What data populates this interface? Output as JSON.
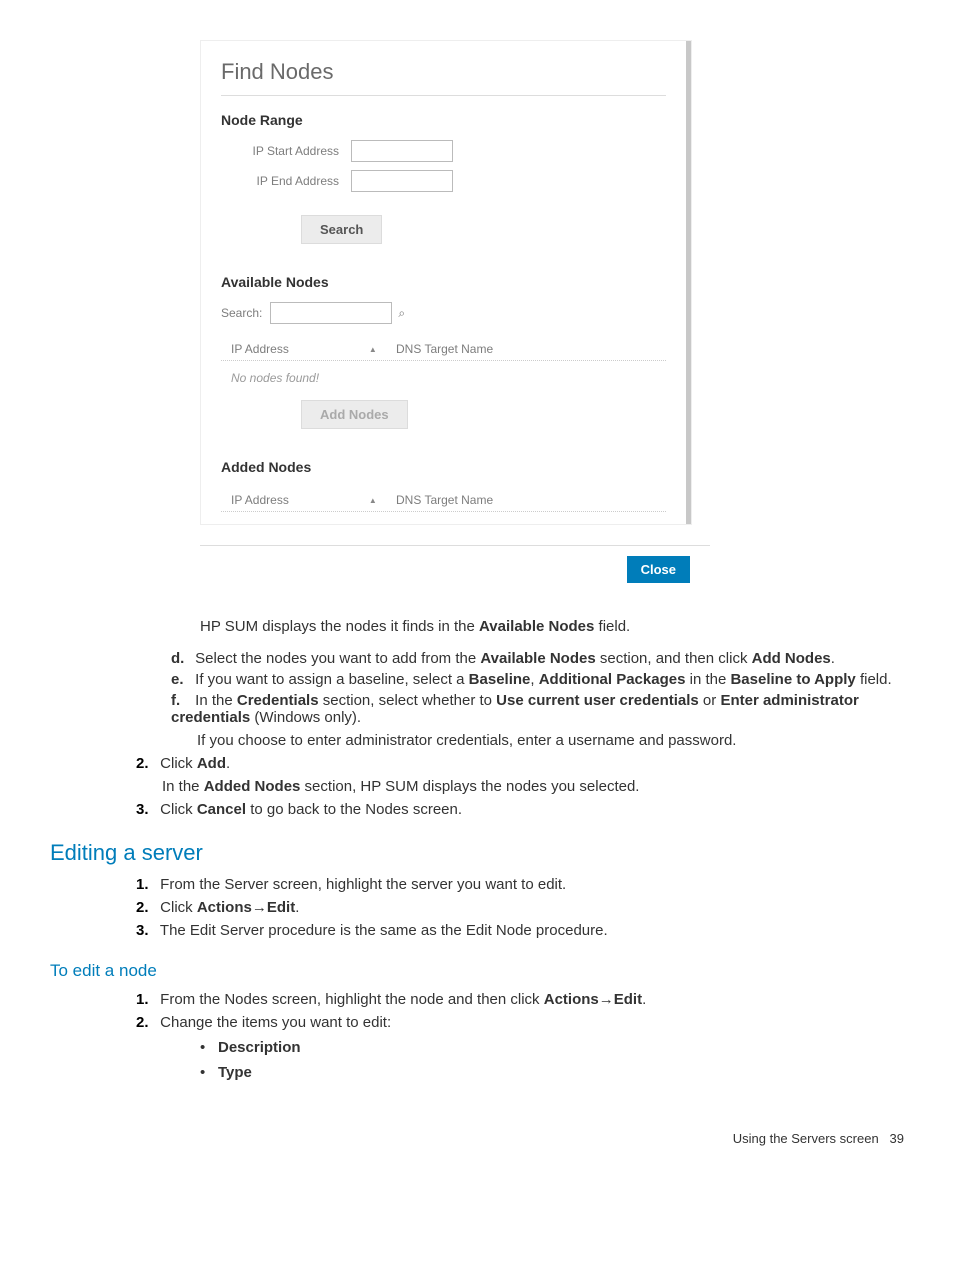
{
  "screenshot": {
    "title": "Find Nodes",
    "section_node_range": "Node Range",
    "label_ip_start": "IP Start Address",
    "label_ip_end": "IP End Address",
    "btn_search": "Search",
    "section_available": "Available Nodes",
    "search_label": "Search:",
    "col_ip": "IP Address",
    "col_dns": "DNS Target Name",
    "no_nodes": "No nodes found!",
    "btn_add_nodes": "Add Nodes",
    "section_added": "Added Nodes",
    "btn_close": "Close"
  },
  "doc": {
    "p1_a": "HP SUM displays the nodes it finds in the ",
    "p1_b": "Available Nodes",
    "p1_c": " field.",
    "d_a": "Select the nodes you want to add from the ",
    "d_b": "Available Nodes",
    "d_c": " section, and then click ",
    "d_d": "Add Nodes",
    "d_e": ".",
    "e_a": "If you want to assign a baseline, select a ",
    "e_b": "Baseline",
    "e_c": ", ",
    "e_d": "Additional Packages",
    "e_e": " in the ",
    "e_f": "Baseline to Apply",
    "e_g": " field.",
    "f_a": "In the ",
    "f_b": "Credentials",
    "f_c": " section, select whether to ",
    "f_d": "Use current user credentials",
    "f_e": " or ",
    "f_f": "Enter administrator credentials",
    "f_g": " (Windows only).",
    "f_note": "If you choose to enter administrator credentials, enter a username and password.",
    "s2_a": "Click ",
    "s2_b": "Add",
    "s2_c": ".",
    "s2_note_a": "In the ",
    "s2_note_b": "Added Nodes",
    "s2_note_c": " section, HP SUM displays the nodes you selected.",
    "s3_a": "Click ",
    "s3_b": "Cancel",
    "s3_c": " to go back to the Nodes screen.",
    "h2_editing": "Editing a server",
    "edit1": "From the Server screen, highlight the server you want to edit.",
    "edit2_a": "Click ",
    "edit2_b": "Actions",
    "edit2_arrow": "→",
    "edit2_c": "Edit",
    "edit2_d": ".",
    "edit3": "The Edit Server procedure is the same as the Edit Node procedure.",
    "h3_toedit": "To edit a node",
    "node1_a": "From the Nodes screen, highlight the node and then click ",
    "node1_b": "Actions",
    "node1_arrow": "→",
    "node1_c": "Edit",
    "node1_d": ".",
    "node2": "Change the items you want to edit:",
    "bullet_desc": "Description",
    "bullet_type": "Type"
  },
  "footer": {
    "text": "Using the Servers screen",
    "page": "39"
  },
  "markers": {
    "d": "d.",
    "e": "e.",
    "f": "f.",
    "n1": "1.",
    "n2": "2.",
    "n3": "3."
  }
}
